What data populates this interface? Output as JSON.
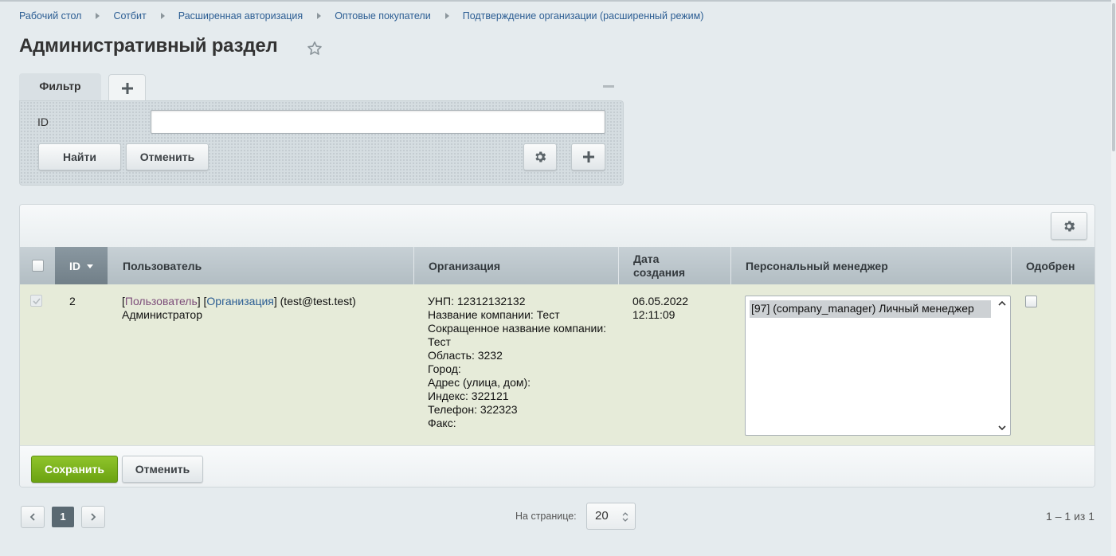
{
  "breadcrumb": [
    "Рабочий стол",
    "Сотбит",
    "Расширенная авторизация",
    "Оптовые покупатели",
    "Подтверждение организации (расширенный режим)"
  ],
  "page_title": "Административный раздел",
  "filter": {
    "tab_label": "Фильтр",
    "id_label": "ID",
    "id_value": "",
    "find_button": "Найти",
    "cancel_button": "Отменить"
  },
  "grid": {
    "columns": {
      "id": "ID",
      "user": "Пользователь",
      "organization": "Организация",
      "date_line1": "Дата",
      "date_line2": "создания",
      "manager": "Персональный менеджер",
      "approved": "Одобрен"
    },
    "row": {
      "id": "2",
      "user_bracket_open1": "[",
      "user_link": "Пользователь",
      "user_bracket_mid": "] [",
      "org_link": "Организация",
      "user_rest": "] (test@test.test)",
      "user_line2": "Администратор",
      "org_lines": [
        "УНП: 12312132132",
        "Название компании: Тест",
        "Сокращенное название компании:",
        "Тест",
        "Область: 3232",
        "Город:",
        "Адрес (улица, дом):",
        "Индекс: 322121",
        "Телефон: 322323",
        "Факс:"
      ],
      "date_line1": "06.05.2022",
      "date_line2": "12:11:09",
      "manager_option": "[97] (company_manager) Личный менеджер",
      "approved": false
    },
    "save_button": "Сохранить",
    "cancel_button": "Отменить"
  },
  "pagination": {
    "current_page": "1",
    "per_page_label": "На странице:",
    "per_page_value": "20",
    "range_text": "1 – 1 из 1"
  },
  "colors": {
    "accent_green": "#7ab31e",
    "link_blue": "#2b5d93",
    "row_bg": "#e6ebd9"
  }
}
